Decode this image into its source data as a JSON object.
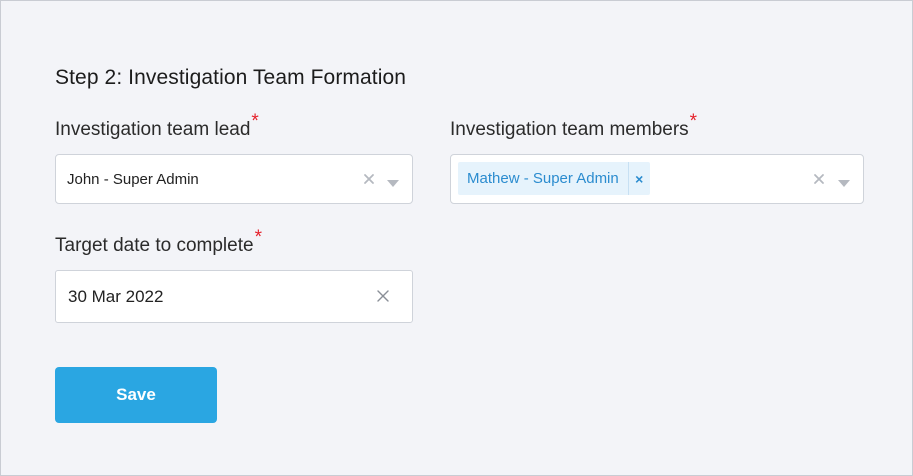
{
  "form": {
    "step_title": "Step 2: Investigation Team Formation",
    "team_lead": {
      "label": "Investigation team lead",
      "required_mark": "*",
      "selected_value": "John - Super Admin"
    },
    "team_members": {
      "label": "Investigation team members",
      "required_mark": "*",
      "selected_chips": [
        {
          "label": "Mathew - Super Admin",
          "remove_glyph": "×"
        }
      ]
    },
    "target_date": {
      "label": "Target date to complete",
      "required_mark": "*",
      "value": "30 Mar 2022"
    },
    "save_label": "Save"
  },
  "colors": {
    "background": "#f3f4f8",
    "required": "#e5212b",
    "chip_background": "#e6f3fc",
    "chip_text": "#2b8ccf",
    "primary_button": "#2aa6e2"
  },
  "icons": {
    "clear": "close-icon",
    "dropdown": "chevron-down-icon",
    "chip_remove": "close-icon"
  }
}
